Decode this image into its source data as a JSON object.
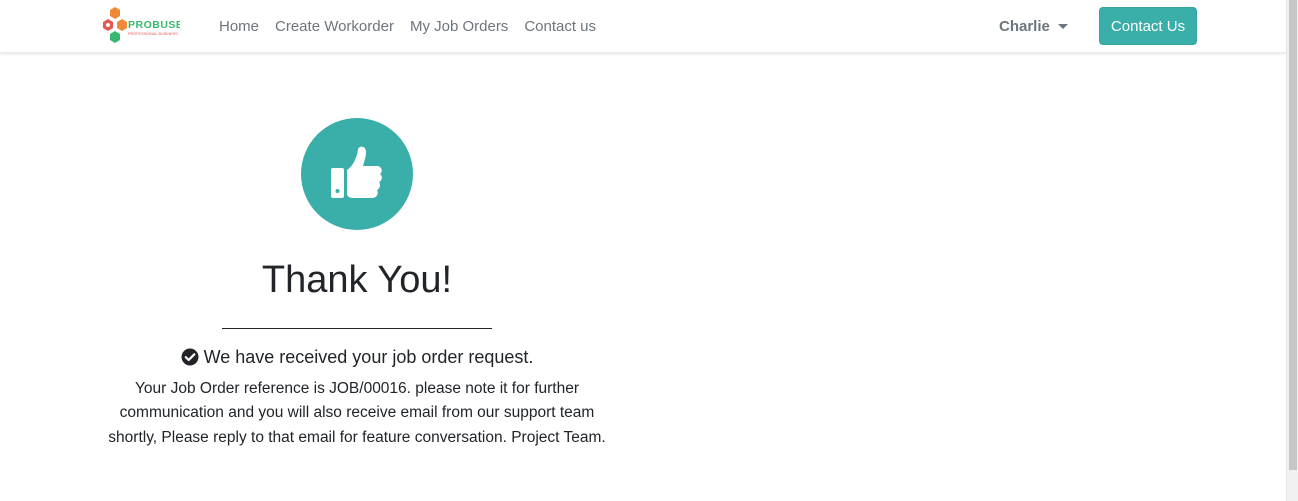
{
  "brand": {
    "name": "PROBUSE",
    "tagline": "PROFESSIONAL BUSINESS",
    "colors": {
      "orange": "#ef8a3a",
      "red": "#e5574f",
      "green": "#38b86e"
    }
  },
  "nav": {
    "links": [
      {
        "label": "Home"
      },
      {
        "label": "Create Workorder"
      },
      {
        "label": "My Job Orders"
      },
      {
        "label": "Contact us"
      }
    ],
    "user": {
      "name": "Charlie",
      "icon": "caret-down-icon"
    },
    "contact_button": "Contact Us"
  },
  "main": {
    "icon": "thumbs-up-icon",
    "title": "Thank You!",
    "received_icon": "check-circle-icon",
    "received_message": "We have received your job order request.",
    "details": "Your Job Order reference is JOB/00016. please note it for further communication and you will also receive email from our support team shortly, Please reply to that email for feature conversation. Project Team."
  },
  "theme": {
    "accent": "#3aaea9",
    "text": "#212529",
    "nav_text": "#6c757d"
  }
}
